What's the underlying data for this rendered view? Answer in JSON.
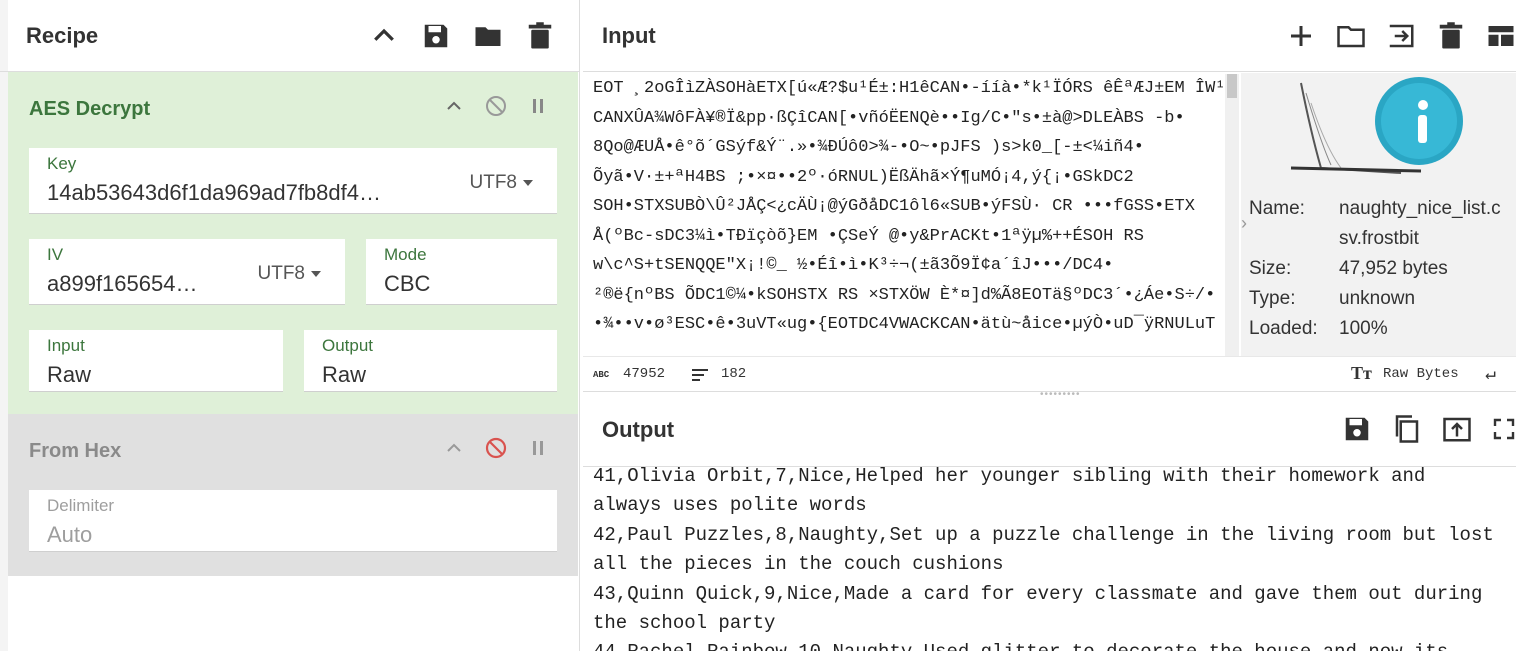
{
  "recipe": {
    "title": "Recipe",
    "operations": [
      {
        "name": "AES Decrypt",
        "key": {
          "label": "Key",
          "value": "14ab53643d6f1da969ad7fb8df4…",
          "encoding": "UTF8"
        },
        "iv": {
          "label": "IV",
          "value": "a899f165654…",
          "encoding": "UTF8"
        },
        "mode": {
          "label": "Mode",
          "value": "CBC"
        },
        "input": {
          "label": "Input",
          "value": "Raw"
        },
        "output": {
          "label": "Output",
          "value": "Raw"
        }
      },
      {
        "name": "From Hex",
        "delimiter": {
          "label": "Delimiter",
          "value": "Auto"
        }
      }
    ]
  },
  "input": {
    "title": "Input",
    "lines": [
      "EOT ¸2oGÎìZÀSOHàETX[ú«Æ?$u¹É±:H1êCAN•-ííà•*k¹ÏÓRS êÊªÆJ±EM ÎW¹",
      "CANXÛA¾WôFÀ¥®Ï&pp·ßÇîCAN[•vñóËENQè••Ig/C•\"s•±à@>DLEÀBS -b•",
      "8Qo@ÆUÅ•ê°õ´GSýf&Ý¨.»•¾ÐÚô0>¾-•O~•pJFS )s>k0_[-±<¼iñ4•",
      "Õyã•V·±+ªH4BS ;•×¤••2º·óRNUL)ËßÄhã×Ý¶uMÓ¡4,ý{¡•GSkDC2",
      "SOH•STXSUBÒ\\Û²JÅÇ<¿cÄÙ¡@ýGðåDC1ôl6«SUB•ýFSÙ· CR •••fGSS•ETX",
      "Å(ºBc-sDC3¼ì•TÐïçòõ}EM •ÇSeÝ   @•y&PrACKt•1ªÿµ%++ÉSOH RS",
      "w\\c^S+tSENQQE\"X¡!©_ ½•Éî•ì•K³÷¬(±ã3Õ9Ï¢a´îJ•••/DC4•",
      "²®ë{nºBS ÕDC1©¼•kSOHSTX RS ×STXÖW    È*¤]d%Ã8EOTä§ºDC3´•¿Áe•S÷/• CR",
      "•¾••v•ø³ESC•ê•3uVT«ug•{EOTDC4VWACKCAN•ätù~åice•µýÒ•uD¯ÿRNULuT"
    ],
    "file": {
      "name_label": "Name:",
      "name_value": "naughty_nice_list.c sv.frostbit",
      "size_label": "Size:",
      "size_value": "47,952 bytes",
      "type_label": "Type:",
      "type_value": "unknown",
      "loaded_label": "Loaded:",
      "loaded_value": "100%"
    },
    "status": {
      "length_icon": "abc-icon",
      "length": "47952",
      "lines_icon": "lines-icon",
      "lines": "182",
      "format": "Raw Bytes"
    }
  },
  "output": {
    "title": "Output",
    "text": "41,Olivia Orbit,7,Nice,Helped her younger sibling with their homework and\nalways uses polite words\n42,Paul Puzzles,8,Naughty,Set up a puzzle challenge in the living room but lost\nall the pieces in the couch cushions\n43,Quinn Quick,9,Nice,Made a card for every classmate and gave them out during\nthe school party\n44,Rachel Rainbow,10,Naughty,Used glitter to decorate the house and now its"
  },
  "colors": {
    "op_active_bg": "#dff0d8",
    "op_active_title": "#3c763d",
    "op_disabled_bg": "#e0e0e0",
    "disable_red": "#d9534f",
    "control_char": "#dd0000"
  }
}
